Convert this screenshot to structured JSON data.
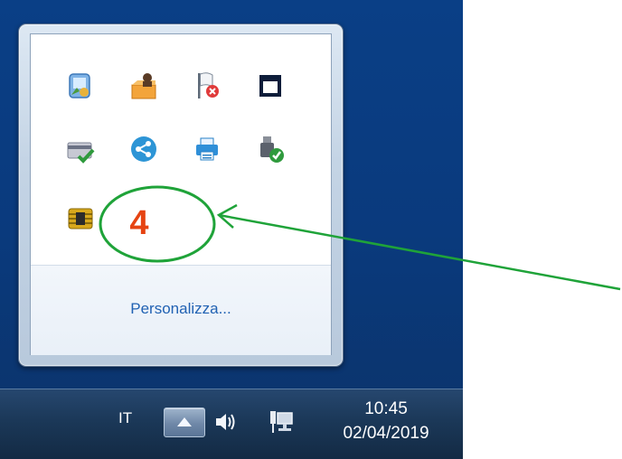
{
  "flyout": {
    "icons": [
      {
        "name": "windows-mobile-center-icon"
      },
      {
        "name": "user-folder-icon"
      },
      {
        "name": "action-center-flag-error-icon"
      },
      {
        "name": "window-square-icon"
      },
      {
        "name": "card-check-icon"
      },
      {
        "name": "share-icon"
      },
      {
        "name": "printer-icon"
      },
      {
        "name": "usb-safely-remove-icon"
      },
      {
        "name": "smartcard-chip-icon"
      }
    ],
    "number_icon": "4",
    "customize_label": "Personalizza..."
  },
  "taskbar": {
    "language": "IT",
    "time": "10:45",
    "date": "02/04/2019"
  },
  "colors": {
    "link": "#2162b3",
    "number": "#e64312",
    "annotation": "#1fa339"
  }
}
